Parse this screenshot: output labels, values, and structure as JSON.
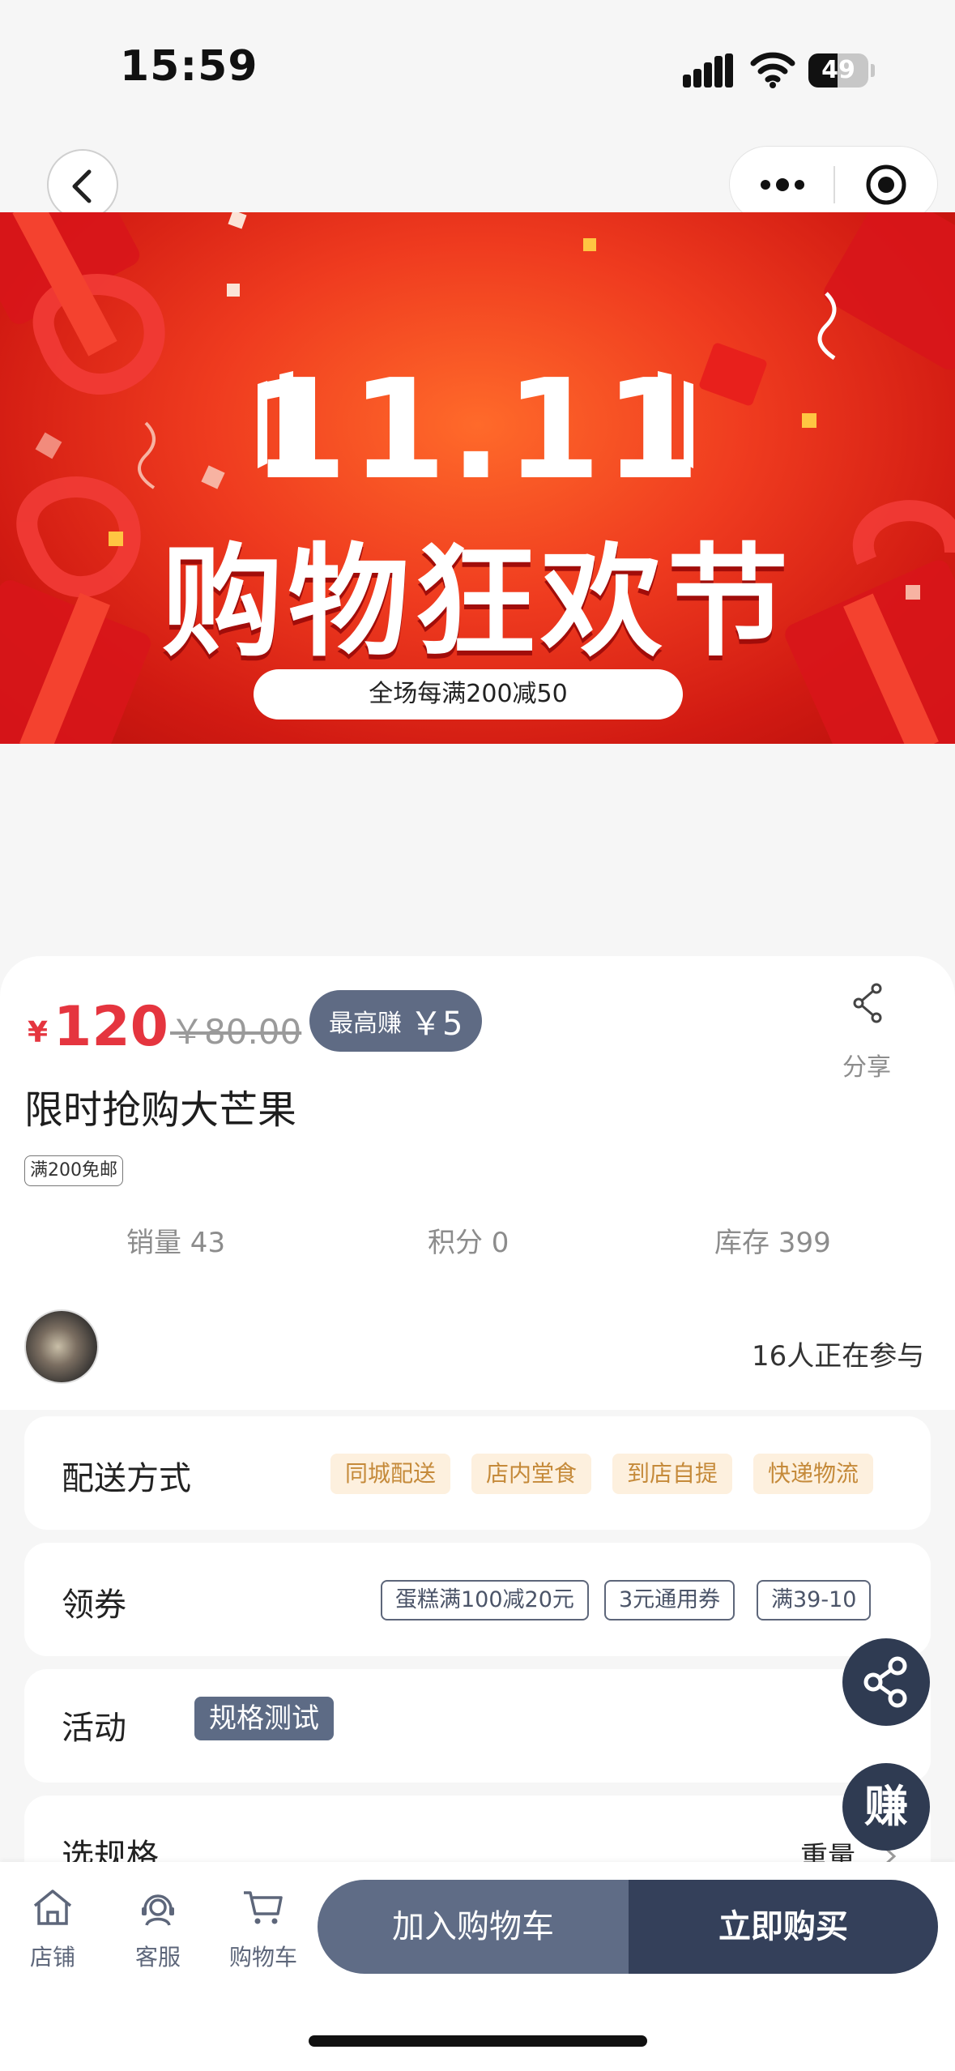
{
  "status_bar": {
    "time": "15:59",
    "battery": "49",
    "battery_level": 0.49
  },
  "nav": {
    "back_icon": "chevron-left-icon",
    "more_icon": "more-dots-icon",
    "close_icon": "target-close-icon"
  },
  "banner": {
    "title_line1": "11.11",
    "title_line2": "购物狂欢节",
    "promo": "全场每满200减50"
  },
  "product": {
    "currency": "¥",
    "price": "120",
    "original_price": "￥80.00",
    "earn_label": "最高赚",
    "earn_value": "￥5",
    "share_label": "分享",
    "title": "限时抢购大芒果",
    "shipping_tag": "满200免邮",
    "sales": "销量 43",
    "points": "积分 0",
    "stock": "库存 399"
  },
  "participants": {
    "text": "16人正在参与"
  },
  "delivery": {
    "label": "配送方式",
    "options": [
      "同城配送",
      "店内堂食",
      "到店自提",
      "快递物流"
    ]
  },
  "coupon": {
    "label": "领券",
    "items": [
      "蛋糕满100减20元",
      "3元通用券",
      "满39-10"
    ]
  },
  "activity": {
    "label": "活动",
    "tag": "规格测试"
  },
  "spec": {
    "label": "选规格",
    "value": "重量"
  },
  "floating": {
    "earn": "赚"
  },
  "bottom_nav": {
    "store": "店铺",
    "service": "客服",
    "cart": "购物车",
    "add_to_cart": "加入购物车",
    "buy_now": "立即购买"
  },
  "colors": {
    "price_red": "#e5353f",
    "dark_navy": "#34405a",
    "slate": "#5f6c86",
    "delivery_tag_bg": "#fdf0de",
    "delivery_tag_text": "#c58a3a"
  }
}
